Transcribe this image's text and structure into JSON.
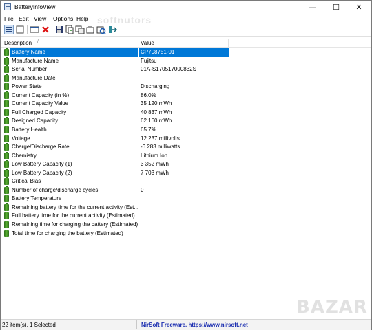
{
  "window": {
    "title": "BatteryInfoView",
    "minimize": "—",
    "maximize": "☐",
    "close": "✕"
  },
  "menu": [
    "File",
    "Edit",
    "View",
    "Options",
    "Help"
  ],
  "watermark_top": "softnutors",
  "toolbar": {
    "icons": [
      "view-list-icon",
      "view-details-icon",
      "properties-icon",
      "delete-icon",
      "save-icon",
      "copy-icon",
      "html-report-icon",
      "select-all-icon",
      "refresh-icon",
      "exit-icon"
    ]
  },
  "columns": {
    "description": "Description",
    "sort_indicator": "/",
    "value": "Value"
  },
  "rows": [
    {
      "desc": "Battery Name",
      "value": "CP708751-01"
    },
    {
      "desc": "Manufacture Name",
      "value": "Fujitsu"
    },
    {
      "desc": "Serial Number",
      "value": "01A-S170517000832S"
    },
    {
      "desc": "Manufacture Date",
      "value": ""
    },
    {
      "desc": "Power State",
      "value": "Discharging"
    },
    {
      "desc": "Current Capacity (in %)",
      "value": "86.0%"
    },
    {
      "desc": "Current Capacity Value",
      "value": "35 120 mWh"
    },
    {
      "desc": "Full Charged Capacity",
      "value": "40 837 mWh"
    },
    {
      "desc": "Designed Capacity",
      "value": "62 160 mWh"
    },
    {
      "desc": "Battery Health",
      "value": "65.7%"
    },
    {
      "desc": "Voltage",
      "value": "12 237 millivolts"
    },
    {
      "desc": "Charge/Discharge Rate",
      "value": "-6 283 milliwatts"
    },
    {
      "desc": "Chemistry",
      "value": "Lithium Ion"
    },
    {
      "desc": "Low Battery Capacity (1)",
      "value": "3 352 mWh"
    },
    {
      "desc": "Low Battery Capacity (2)",
      "value": "7 703 mWh"
    },
    {
      "desc": "Critical Bias",
      "value": ""
    },
    {
      "desc": "Number of charge/discharge cycles",
      "value": "0"
    },
    {
      "desc": "Battery Temperature",
      "value": ""
    },
    {
      "desc": "Remaining battery time for the current activity (Est...",
      "value": ""
    },
    {
      "desc": "Full battery time for the current activity (Estimated)",
      "value": ""
    },
    {
      "desc": "Remaining time for charging the battery (Estimated)",
      "value": ""
    },
    {
      "desc": "Total  time for charging the battery (Estimated)",
      "value": ""
    }
  ],
  "selected_row": 0,
  "status": {
    "items": "22 item(s), 1 Selected",
    "link": "NirSoft Freeware.  https://www.nirsoft.net"
  },
  "watermark_bottom": "BAZAR",
  "colors": {
    "selection": "#0078d7",
    "link": "#1a2db0"
  }
}
